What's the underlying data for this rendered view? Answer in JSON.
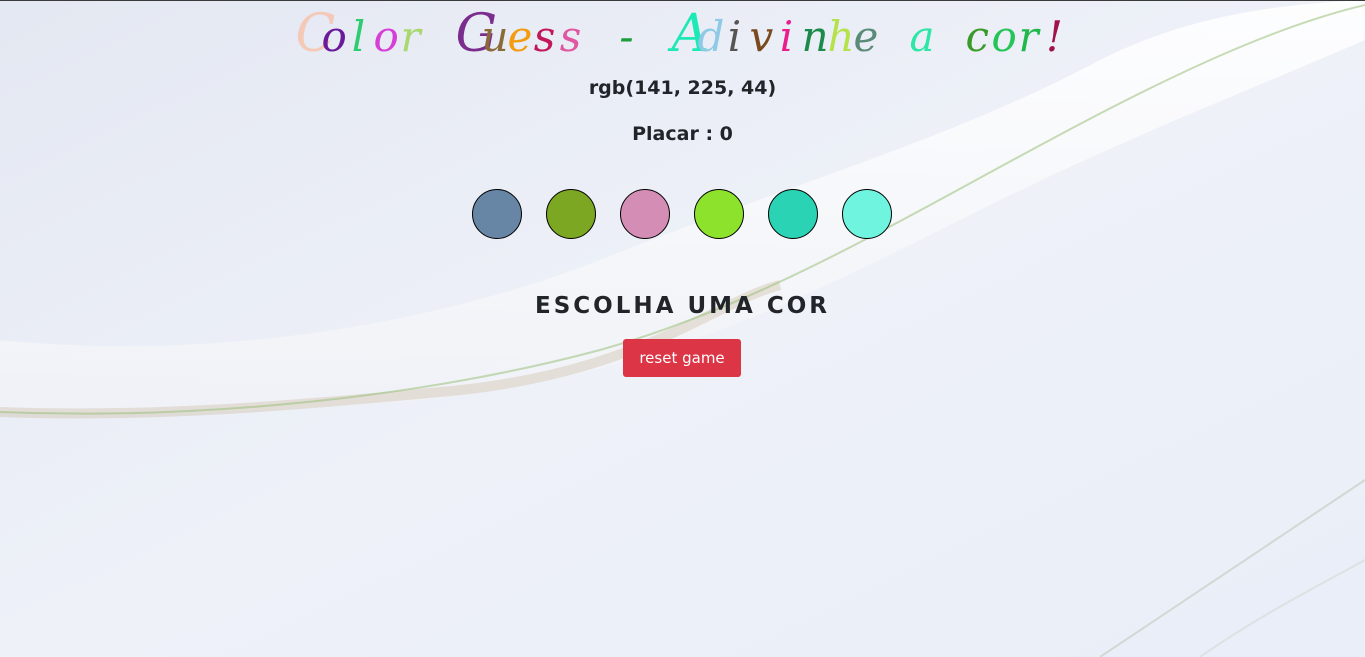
{
  "title": {
    "letters": [
      {
        "ch": "C",
        "color": "#f4c9b8"
      },
      {
        "ch": "o",
        "color": "#6a1b9a"
      },
      {
        "ch": "l",
        "color": "#2ecc71"
      },
      {
        "ch": "o",
        "color": "#d63fd6"
      },
      {
        "ch": "r",
        "color": "#a8d86e"
      },
      {
        "ch": " ",
        "color": "#000000"
      },
      {
        "ch": "G",
        "color": "#7b2d8e"
      },
      {
        "ch": "u",
        "color": "#8b6a3a"
      },
      {
        "ch": "e",
        "color": "#f39c12"
      },
      {
        "ch": "s",
        "color": "#c2185b"
      },
      {
        "ch": "s",
        "color": "#e056a0"
      },
      {
        "ch": " ",
        "color": "#000000"
      },
      {
        "ch": "-",
        "color": "#1b9e3a"
      },
      {
        "ch": " ",
        "color": "#000000"
      },
      {
        "ch": "A",
        "color": "#1de9b6"
      },
      {
        "ch": "d",
        "color": "#8ecae6"
      },
      {
        "ch": "i",
        "color": "#555555"
      },
      {
        "ch": "v",
        "color": "#7a4a1e"
      },
      {
        "ch": "i",
        "color": "#e91e8c"
      },
      {
        "ch": "n",
        "color": "#1b8a4a"
      },
      {
        "ch": "h",
        "color": "#b5e24a"
      },
      {
        "ch": "e",
        "color": "#5a8a78"
      },
      {
        "ch": " ",
        "color": "#000000"
      },
      {
        "ch": "a",
        "color": "#2ee6a6"
      },
      {
        "ch": " ",
        "color": "#000000"
      },
      {
        "ch": "c",
        "color": "#3a9a2a"
      },
      {
        "ch": "o",
        "color": "#27c45a"
      },
      {
        "ch": "r",
        "color": "#1fb84a"
      },
      {
        "ch": "!",
        "color": "#a0124a"
      }
    ]
  },
  "rgb_text": "rgb(141, 225, 44)",
  "score_text": "Placar : 0",
  "circles": [
    {
      "color": "#6785a4"
    },
    {
      "color": "#7ba722"
    },
    {
      "color": "#d48db5"
    },
    {
      "color": "#8de22c"
    },
    {
      "color": "#29d3b4"
    },
    {
      "color": "#6ff4df"
    }
  ],
  "message": "ESCOLHA UMA COR",
  "reset_label": "reset game",
  "colors": {
    "reset_button": "#dc3545",
    "text": "#212529",
    "background": "#eef1f8"
  }
}
